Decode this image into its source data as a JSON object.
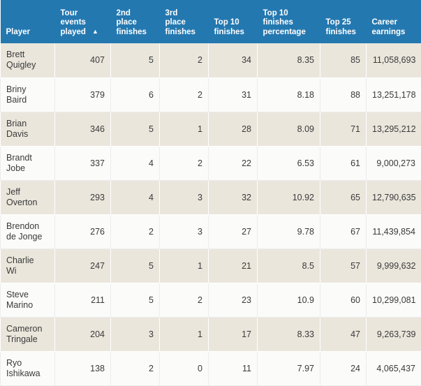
{
  "table": {
    "sort": {
      "column": "Tour events played",
      "direction": "ascending",
      "caret_glyph": "▲"
    },
    "colors": {
      "header_background": "#2478b0",
      "header_text": "#ffffff",
      "row_odd_background": "#eae6dc",
      "row_even_background": "#fbfbfa",
      "body_text": "#3a3a3a"
    },
    "columns": [
      {
        "key": "player",
        "label": "Player",
        "label_lines": [
          "Player"
        ],
        "align": "left"
      },
      {
        "key": "events",
        "label": "Tour events played",
        "label_lines": [
          "Tour",
          "events",
          "played"
        ],
        "align": "right",
        "sorted": true
      },
      {
        "key": "second",
        "label": "2nd place finishes",
        "label_lines": [
          "2nd",
          "place",
          "finishes"
        ],
        "align": "right"
      },
      {
        "key": "third",
        "label": "3rd place finishes",
        "label_lines": [
          "3rd",
          "place",
          "finishes"
        ],
        "align": "right"
      },
      {
        "key": "top10",
        "label": "Top 10 finishes",
        "label_lines": [
          "Top 10",
          "finishes"
        ],
        "align": "right"
      },
      {
        "key": "top10pct",
        "label": "Top 10 finishes percentage",
        "label_lines": [
          "Top 10",
          "finishes",
          "percentage"
        ],
        "align": "right"
      },
      {
        "key": "top25",
        "label": "Top 25 finishes",
        "label_lines": [
          "Top 25",
          "finishes"
        ],
        "align": "right"
      },
      {
        "key": "career",
        "label": "Career earnings",
        "label_lines": [
          "Career",
          "earnings"
        ],
        "align": "right"
      }
    ],
    "rows": [
      {
        "player_lines": [
          "Brett",
          "Quigley"
        ],
        "events": "407",
        "second": "5",
        "third": "2",
        "top10": "34",
        "top10pct": "8.35",
        "top25": "85",
        "career": "11,058,693"
      },
      {
        "player_lines": [
          "Briny",
          "Baird"
        ],
        "events": "379",
        "second": "6",
        "third": "2",
        "top10": "31",
        "top10pct": "8.18",
        "top25": "88",
        "career": "13,251,178"
      },
      {
        "player_lines": [
          "Brian",
          "Davis"
        ],
        "events": "346",
        "second": "5",
        "third": "1",
        "top10": "28",
        "top10pct": "8.09",
        "top25": "71",
        "career": "13,295,212"
      },
      {
        "player_lines": [
          "Brandt",
          "Jobe"
        ],
        "events": "337",
        "second": "4",
        "third": "2",
        "top10": "22",
        "top10pct": "6.53",
        "top25": "61",
        "career": "9,000,273"
      },
      {
        "player_lines": [
          "Jeff",
          "Overton"
        ],
        "events": "293",
        "second": "4",
        "third": "3",
        "top10": "32",
        "top10pct": "10.92",
        "top25": "65",
        "career": "12,790,635"
      },
      {
        "player_lines": [
          "Brendon",
          "de Jonge"
        ],
        "events": "276",
        "second": "2",
        "third": "3",
        "top10": "27",
        "top10pct": "9.78",
        "top25": "67",
        "career": "11,439,854"
      },
      {
        "player_lines": [
          "Charlie",
          "Wi"
        ],
        "events": "247",
        "second": "5",
        "third": "1",
        "top10": "21",
        "top10pct": "8.5",
        "top25": "57",
        "career": "9,999,632"
      },
      {
        "player_lines": [
          "Steve",
          "Marino"
        ],
        "events": "211",
        "second": "5",
        "third": "2",
        "top10": "23",
        "top10pct": "10.9",
        "top25": "60",
        "career": "10,299,081"
      },
      {
        "player_lines": [
          "Cameron",
          "Tringale"
        ],
        "events": "204",
        "second": "3",
        "third": "1",
        "top10": "17",
        "top10pct": "8.33",
        "top25": "47",
        "career": "9,263,739"
      },
      {
        "player_lines": [
          "Ryo",
          "Ishikawa"
        ],
        "events": "138",
        "second": "2",
        "third": "0",
        "top10": "11",
        "top10pct": "7.97",
        "top25": "24",
        "career": "4,065,437"
      }
    ]
  }
}
